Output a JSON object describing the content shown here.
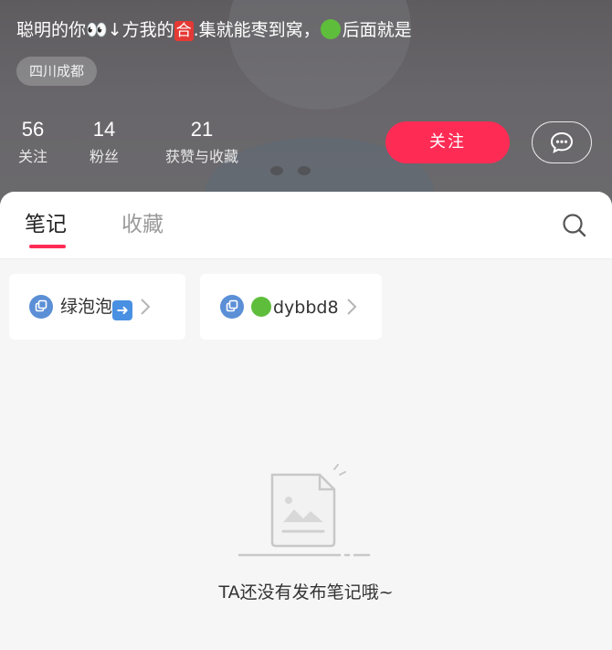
{
  "profile": {
    "bio_parts": {
      "p1": "聪明的你",
      "eyes": "👀",
      "p2": "↓方我的",
      "he": "合",
      "p3": ".集就能枣到窝，",
      "p4": "后面就是"
    },
    "location": "四川成都",
    "stats": [
      {
        "value": "56",
        "label": "关注"
      },
      {
        "value": "14",
        "label": "粉丝"
      },
      {
        "value": "21",
        "label": "获赞与收藏"
      }
    ],
    "follow_label": "关注",
    "message_icon": "chat-bubble-icon"
  },
  "tabs": [
    {
      "label": "笔记",
      "active": true
    },
    {
      "label": "收藏",
      "active": false
    }
  ],
  "collections": [
    {
      "label": "绿泡泡",
      "suffix_emoji": "➡️",
      "icon": "stack-icon"
    },
    {
      "label": "dybbd8",
      "prefix_emoji": "green-circle",
      "icon": "stack-icon"
    }
  ],
  "empty_state": {
    "message": "TA还没有发布笔记哦~",
    "icon": "empty-document-icon"
  },
  "colors": {
    "accent": "#fe2c55",
    "header_bg": "#646266",
    "chip_icon": "#4a90e2",
    "green_circle": "#5fbd3c"
  }
}
